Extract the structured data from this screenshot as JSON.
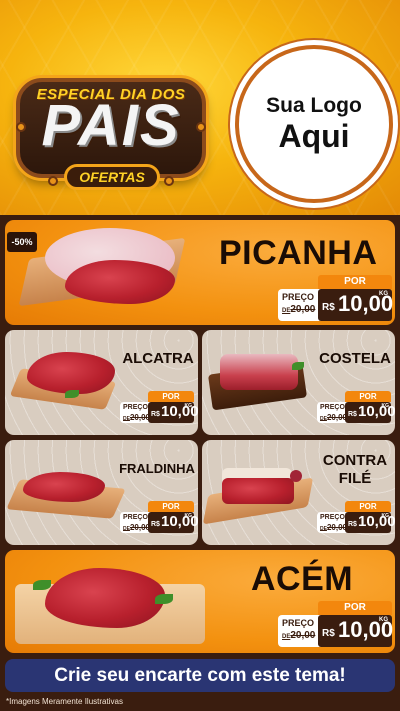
{
  "header": {
    "badge_top": "ESPECIAL DIA DOS",
    "badge_main": "PAIS",
    "badge_ribbon": "OFERTAS",
    "logo_line1": "Sua Logo",
    "logo_line2": "Aqui"
  },
  "discount_badge": "-50%",
  "products": [
    {
      "name": "PICANHA",
      "por": "POR",
      "preco": "PREÇO",
      "de": "DE",
      "old": "20,00",
      "rs": "R$",
      "value": "10,00",
      "unit": "KG"
    },
    {
      "name": "ALCATRA",
      "por": "POR",
      "preco": "PREÇO",
      "de": "DE",
      "old": "20,00",
      "rs": "R$",
      "value": "10,00",
      "unit": "KG"
    },
    {
      "name": "COSTELA",
      "por": "POR",
      "preco": "PREÇO",
      "de": "DE",
      "old": "20,00",
      "rs": "R$",
      "value": "10,00",
      "unit": "KG"
    },
    {
      "name": "FRALDINHA",
      "por": "POR",
      "preco": "PREÇO",
      "de": "DE",
      "old": "20,00",
      "rs": "R$",
      "value": "10,00",
      "unit": "KG"
    },
    {
      "name_line1": "CONTRA",
      "name_line2": "FILÉ",
      "por": "POR",
      "preco": "PREÇO",
      "de": "DE",
      "old": "20,00",
      "rs": "R$",
      "value": "10,00",
      "unit": "KG"
    },
    {
      "name": "ACÉM",
      "por": "POR",
      "preco": "PREÇO",
      "de": "DE",
      "old": "20,00",
      "rs": "R$",
      "value": "10,00",
      "unit": "KG"
    }
  ],
  "cta": "Crie seu encarte com este tema!",
  "disclaimer": "*Imagens Meramente Ilustrativas",
  "colors": {
    "orange": "#f3910f",
    "brown": "#3a1d0f",
    "navy": "#2a3573"
  }
}
